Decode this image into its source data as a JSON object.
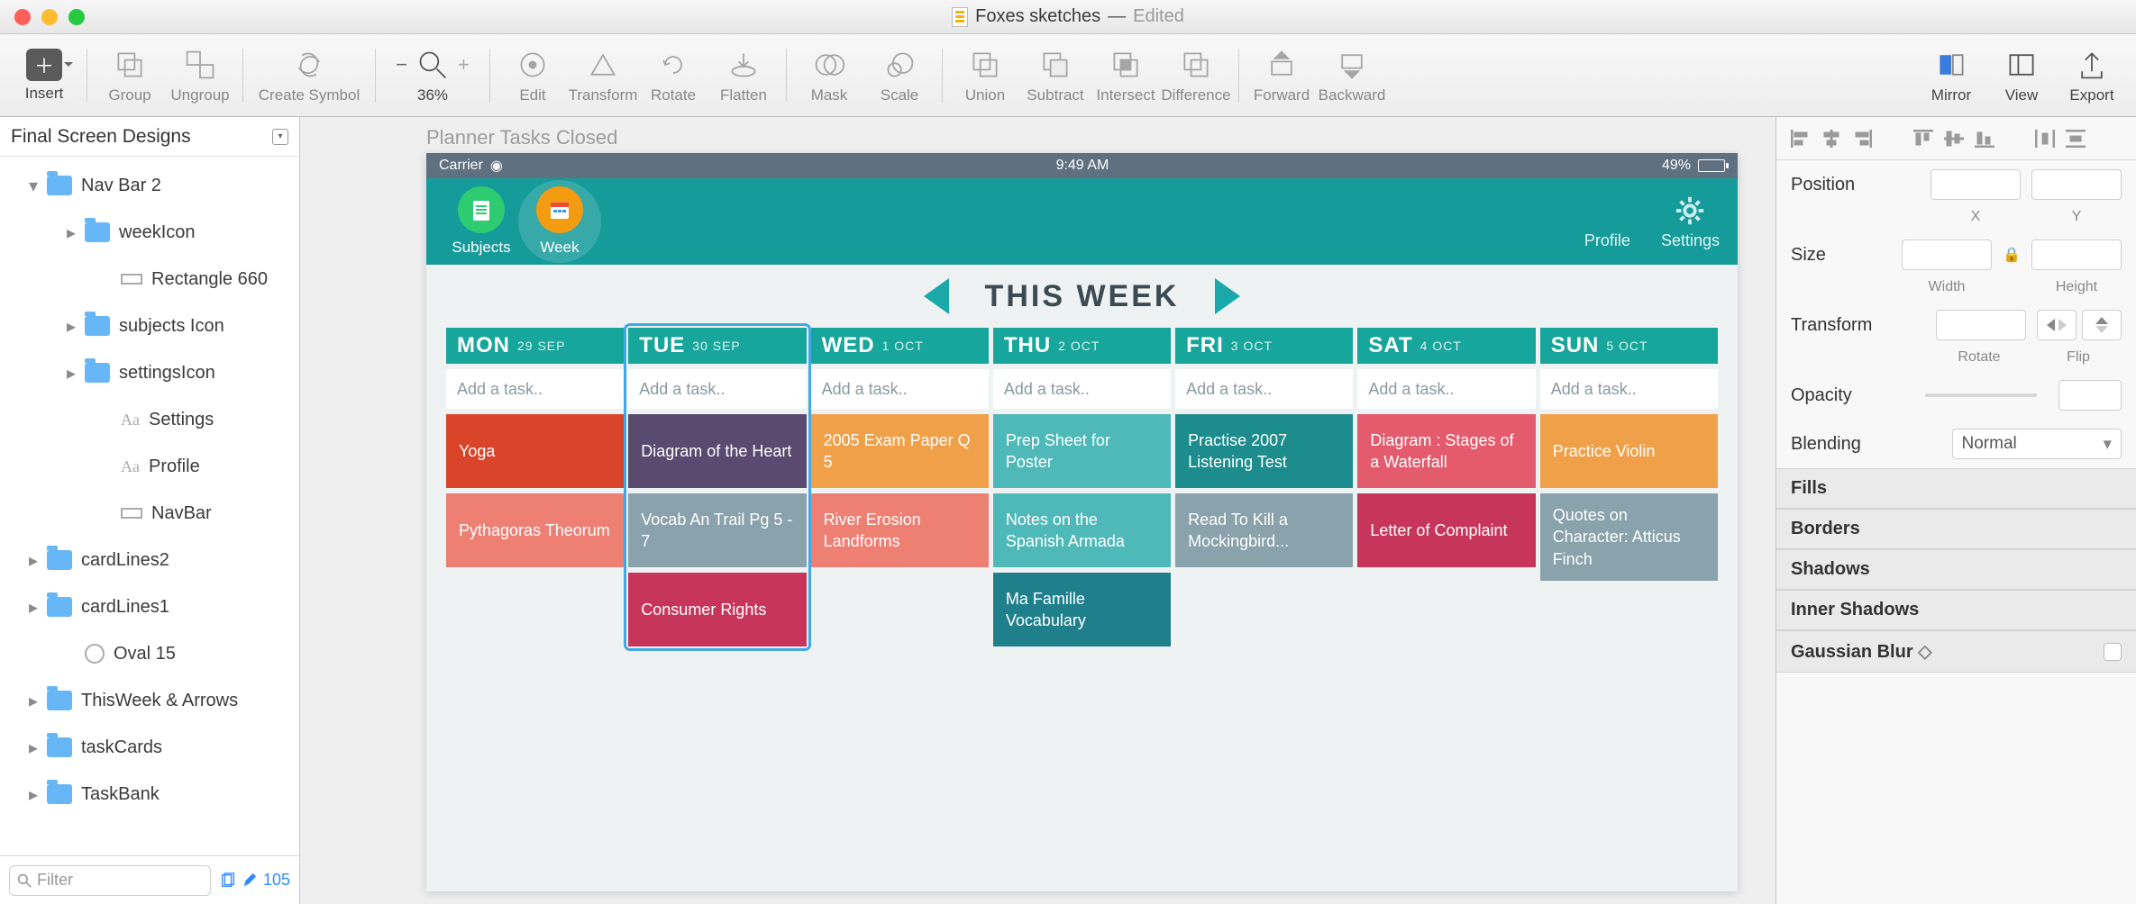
{
  "window": {
    "filename": "Foxes sketches",
    "edited": "Edited"
  },
  "toolbar": {
    "insert": "Insert",
    "group": "Group",
    "ungroup": "Ungroup",
    "create_symbol": "Create Symbol",
    "zoom_pct": "36%",
    "edit": "Edit",
    "transform": "Transform",
    "rotate": "Rotate",
    "flatten": "Flatten",
    "mask": "Mask",
    "scale": "Scale",
    "union": "Union",
    "subtract": "Subtract",
    "intersect": "Intersect",
    "difference": "Difference",
    "forward": "Forward",
    "backward": "Backward",
    "mirror": "Mirror",
    "view": "View",
    "export": "Export"
  },
  "sidebar": {
    "title": "Final Screen Designs",
    "nodes": {
      "navbar2": "Nav Bar 2",
      "weekIcon": "weekIcon",
      "rect660": "Rectangle 660",
      "subjectsIcon": "subjects Icon",
      "settingsIcon": "settingsIcon",
      "settings_t": "Settings",
      "profile_t": "Profile",
      "navbar": "NavBar",
      "cardLines2": "cardLines2",
      "cardLines1": "cardLines1",
      "oval15": "Oval 15",
      "thisweek": "ThisWeek & Arrows",
      "taskCards": "taskCards",
      "taskBank": "TaskBank"
    },
    "filter_ph": "Filter",
    "layer_count": "105"
  },
  "canvas": {
    "page_label": "Planner Tasks Closed",
    "status": {
      "carrier": "Carrier",
      "time": "9:49 AM",
      "battery": "49%"
    },
    "nav": {
      "subjects": "Subjects",
      "week": "Week",
      "profile": "Profile",
      "settings": "Settings"
    },
    "week_title": "THIS WEEK",
    "days": [
      {
        "name": "MON",
        "date": "29 SEP",
        "add": "Add a task..",
        "cards": [
          {
            "t": "Yoga",
            "c": "c-red"
          },
          {
            "t": "Pythagoras Theorum",
            "c": "c-coral"
          }
        ]
      },
      {
        "name": "TUE",
        "date": "30 SEP",
        "add": "Add a task..",
        "selected": true,
        "cards": [
          {
            "t": "Diagram of the Heart",
            "c": "c-purple"
          },
          {
            "t": "Vocab An Trail Pg 5 - 7",
            "c": "c-grayT"
          },
          {
            "t": "Consumer Rights",
            "c": "c-crimson"
          }
        ]
      },
      {
        "name": "WED",
        "date": "1 OCT",
        "add": "Add a task..",
        "cards": [
          {
            "t": "2005 Exam Paper Q 5",
            "c": "c-orange"
          },
          {
            "t": "River Erosion Landforms",
            "c": "c-coral"
          }
        ]
      },
      {
        "name": "THU",
        "date": "2 OCT",
        "add": "Add a task..",
        "cards": [
          {
            "t": "Prep Sheet for Poster",
            "c": "c-teal"
          },
          {
            "t": "Notes on the Spanish Armada",
            "c": "c-teal"
          },
          {
            "t": "Ma Famille Vocabulary",
            "c": "c-tealD"
          }
        ]
      },
      {
        "name": "FRI",
        "date": "3 OCT",
        "add": "Add a task..",
        "cards": [
          {
            "t": "Practise 2007 Listening Test",
            "c": "c-tealM"
          },
          {
            "t": "Read To Kill a Mockingbird...",
            "c": "c-grayT"
          }
        ]
      },
      {
        "name": "SAT",
        "date": "4 OCT",
        "add": "Add a task..",
        "cards": [
          {
            "t": "Diagram : Stages of a Waterfall",
            "c": "c-pink"
          },
          {
            "t": "Letter of Complaint",
            "c": "c-crimson"
          }
        ]
      },
      {
        "name": "SUN",
        "date": "5 OCT",
        "add": "Add a task..",
        "cards": [
          {
            "t": "Practice Violin",
            "c": "c-orange"
          },
          {
            "t": "Quotes on Character: Atticus Finch",
            "c": "c-grayT"
          }
        ]
      }
    ]
  },
  "inspector": {
    "position": "Position",
    "x": "X",
    "y": "Y",
    "size": "Size",
    "width": "Width",
    "height": "Height",
    "transform": "Transform",
    "rotate_l": "Rotate",
    "flip_l": "Flip",
    "opacity": "Opacity",
    "blending": "Blending",
    "blend_val": "Normal",
    "fills": "Fills",
    "borders": "Borders",
    "shadows": "Shadows",
    "inner_shadows": "Inner Shadows",
    "gauss": "Gaussian Blur"
  }
}
